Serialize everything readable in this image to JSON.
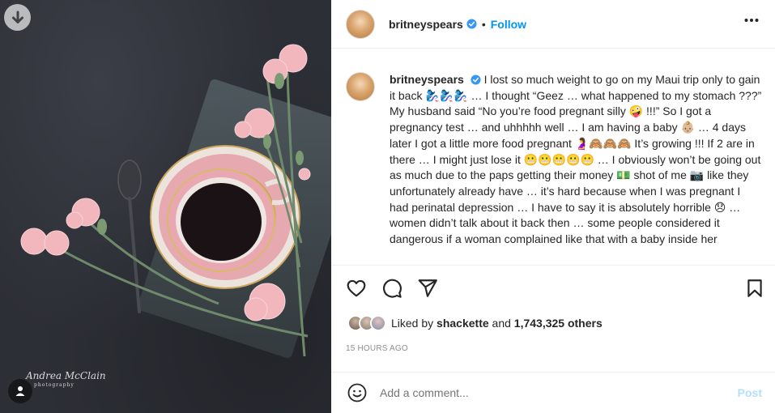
{
  "media": {
    "watermark_name": "Andrea McClain",
    "watermark_sub": "photography",
    "download_icon": "arrow-down-circle-icon",
    "tagged_users_icon": "user-icon"
  },
  "header": {
    "username": "britneyspears",
    "dot": "•",
    "follow_label": "Follow",
    "more_icon": "ellipsis-icon"
  },
  "caption": {
    "username": "britneyspears",
    "text": "I lost so much weight to go on my Maui trip only to gain it back 🧞‍♀️🧞‍♀️🧞‍♀️ … I thought “Geez … what happened to my stomach ???” My husband said “No you’re food pregnant silly 🤪 !!!” So I got a pregnancy test … and uhhhhh well … I am having a baby 👶🏼 … 4 days later I got a little more food pregnant 🤰🙈🙈🙈 It’s growing !!! If 2 are in there … I might just lose it 😬😬😬😬😬 … I obviously won’t be going out as much due to the paps getting their money 💵 shot of me 📷 like they unfortunately already have … it’s hard because when I was pregnant I had perinatal depression … I have to say it is absolutely horrible 😞 … women didn’t talk about it back then … some people considered it dangerous if a woman complained like that with a baby inside her"
  },
  "actions": {
    "like_icon": "heart-icon",
    "comment_icon": "comment-icon",
    "share_icon": "paper-plane-icon",
    "save_icon": "bookmark-icon"
  },
  "likes": {
    "prefix": "Liked by",
    "user": "shackette",
    "and": "and",
    "others": "1,743,325 others"
  },
  "timestamp": "15 HOURS AGO",
  "comment": {
    "placeholder": "Add a comment...",
    "post_label": "Post",
    "emoji_icon": "smiley-icon"
  },
  "colors": {
    "accent": "#0095f6",
    "post_disabled": "#b2dffc",
    "muted": "#8e8e8e"
  }
}
